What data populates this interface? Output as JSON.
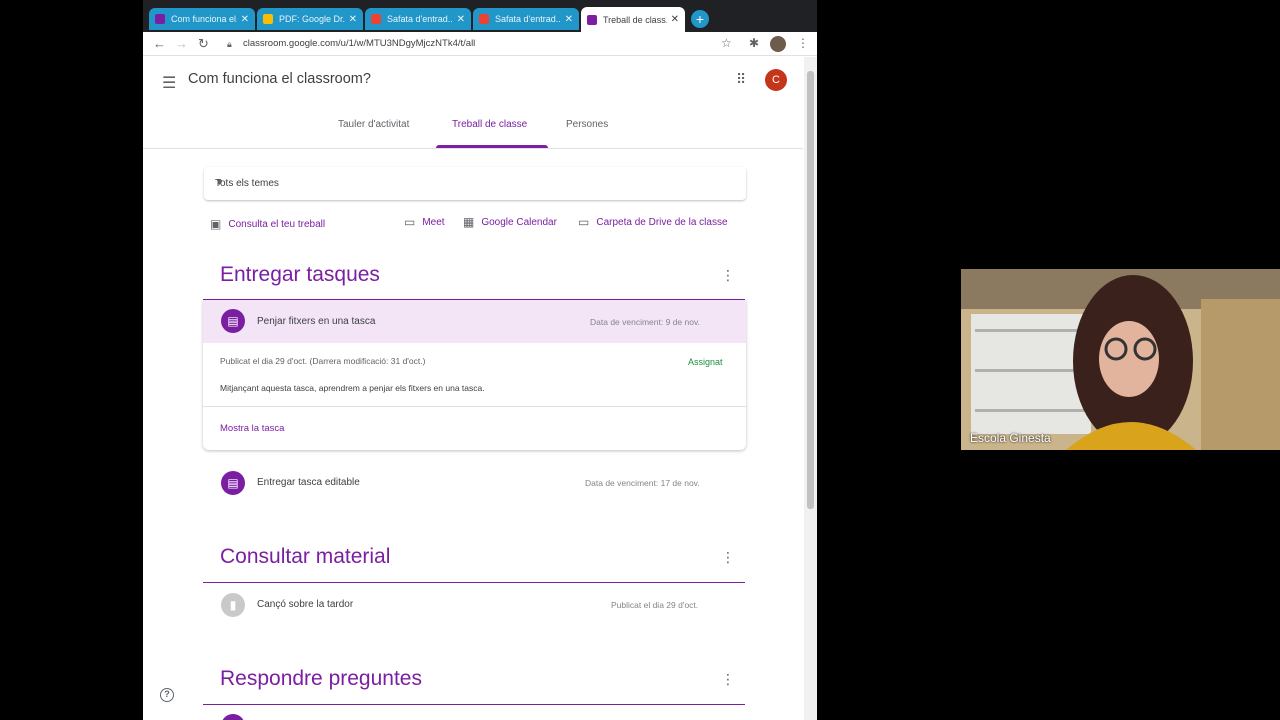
{
  "browser": {
    "tabs": [
      {
        "title": "Com funciona el...",
        "favicon_color": "#7b1fa2"
      },
      {
        "title": "PDF: Google Dr...",
        "favicon_color": "#fbbc04"
      },
      {
        "title": "Safata d'entrad...",
        "favicon_color": "#ea4335"
      },
      {
        "title": "Safata d'entrad...",
        "favicon_color": "#ea4335"
      },
      {
        "title": "Treball de class...",
        "favicon_color": "#7b1fa2"
      }
    ],
    "new_tab": "+",
    "url": "classroom.google.com/u/1/w/MTU3NDgyMjczNTk4/t/all"
  },
  "header": {
    "class_title": "Com funciona el classroom?",
    "avatar_letter": "C",
    "avatar_color": "#c5351b"
  },
  "nav_tabs": [
    "Tauler d'activitat",
    "Treball de classe",
    "Persones"
  ],
  "filter": {
    "selected": "Tots els temes"
  },
  "links": {
    "view_work": "Consulta el teu treball",
    "meet": "Meet",
    "calendar": "Google Calendar",
    "drive": "Carpeta de Drive de la classe"
  },
  "sections": [
    {
      "title": "Entregar tasques",
      "items": [
        {
          "title": "Penjar fitxers en una tasca",
          "due": "Data de venciment: 9 de nov.",
          "published": "Publicat el dia 29 d'oct. (Darrera modificació: 31 d'oct.)",
          "status": "Assignat",
          "description": "Mitjançant aquesta tasca, aprendrem a penjar els fitxers en una tasca.",
          "action": "Mostra la tasca"
        },
        {
          "title": "Entregar tasca editable",
          "due": "Data de venciment: 17 de nov."
        }
      ]
    },
    {
      "title": "Consultar material",
      "items": [
        {
          "title": "Cançó sobre la tardor",
          "due": "Publicat el dia 29 d'oct."
        }
      ]
    },
    {
      "title": "Respondre preguntes",
      "items": []
    }
  ],
  "webcam": {
    "name": "Escola Ginesta"
  },
  "colors": {
    "accent": "#7b1fa2",
    "assigned": "#1e8e3e",
    "tab_blue": "#2196c9"
  }
}
